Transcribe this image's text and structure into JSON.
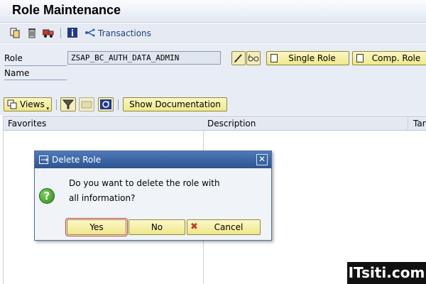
{
  "window": {
    "title": "Role Maintenance"
  },
  "toolbar": {
    "copy_icon": "copy-icon",
    "delete_icon": "trash-icon",
    "transport_icon": "truck-icon",
    "info_icon": "info-icon",
    "transactions_label": "Transactions"
  },
  "form": {
    "role_label": "Role",
    "role_value": "ZSAP_BC_AUTH_DATA_ADMIN",
    "name_label": "Name",
    "single_role_label": "Single Role",
    "comp_role_label": "Comp. Role"
  },
  "nav": {
    "views_label": "Views",
    "show_doc_label": "Show Documentation"
  },
  "table": {
    "columns": [
      "Favorites",
      "Description",
      "Tar"
    ]
  },
  "dialog": {
    "title": "Delete Role",
    "message_line1": "Do you want to delete the role with",
    "message_line2": "all information?",
    "yes_label": "Yes",
    "no_label": "No",
    "cancel_label": "Cancel",
    "close_glyph": "✕",
    "question_glyph": "?"
  },
  "watermark": {
    "text": "ITsiti.com"
  },
  "colors": {
    "button_yellow": "#f0e98a",
    "dialog_title": "#2d548f",
    "toolbar_bg": "#e6ebf3"
  }
}
